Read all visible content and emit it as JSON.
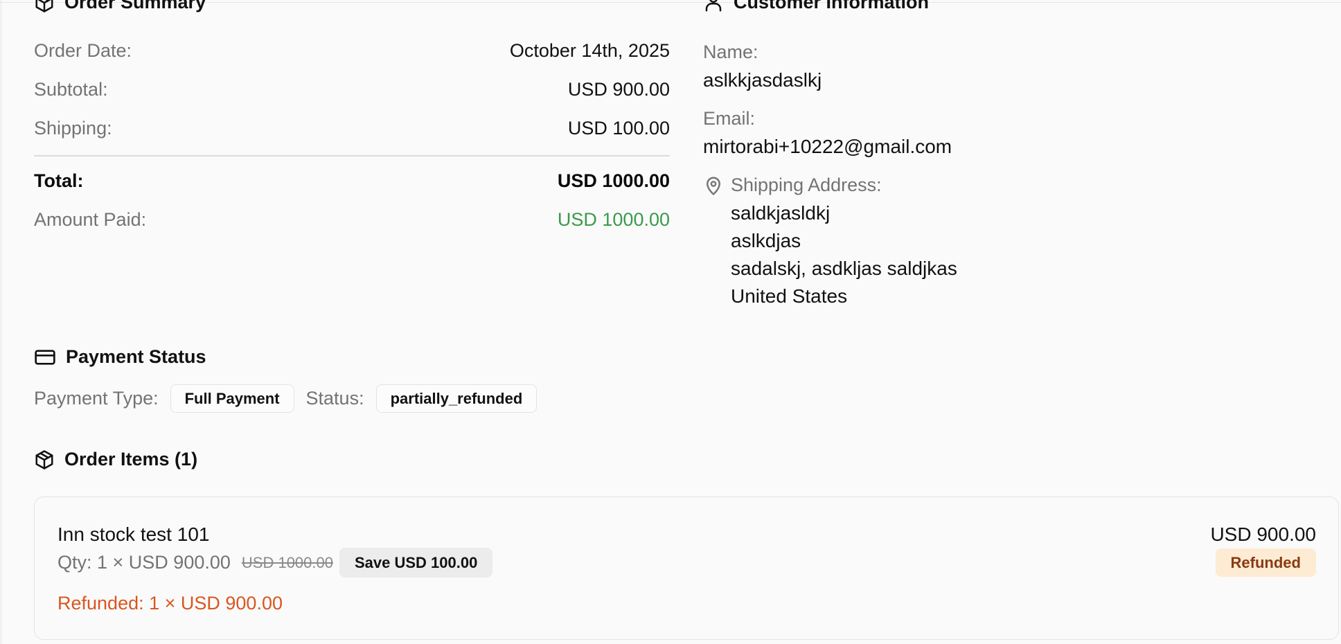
{
  "order_summary": {
    "title": "Order Summary",
    "order_date_label": "Order Date:",
    "order_date_value": "October 14th, 2025",
    "subtotal_label": "Subtotal:",
    "subtotal_value": "USD 900.00",
    "shipping_label": "Shipping:",
    "shipping_value": "USD 100.00",
    "total_label": "Total:",
    "total_value": "USD 1000.00",
    "amount_paid_label": "Amount Paid:",
    "amount_paid_value": "USD 1000.00",
    "icon": "package-icon",
    "paid_color": "#3a9a4a"
  },
  "customer": {
    "title": "Customer Information",
    "icon": "user-icon",
    "name_label": "Name:",
    "name_value": "aslkkjasdaslkj",
    "email_label": "Email:",
    "email_value": "mirtorabi+10222@gmail.com",
    "address_label": "Shipping Address:",
    "address_icon": "map-pin-icon",
    "address_lines": [
      "saldkjasldkj",
      "aslkdjas",
      "sadalskj, asdkljas saldjkas",
      "United States"
    ]
  },
  "payment": {
    "title": "Payment Status",
    "icon": "credit-card-icon",
    "type_label": "Payment Type:",
    "type_value": "Full Payment",
    "status_label": "Status:",
    "status_value": "partially_refunded"
  },
  "items": {
    "title": "Order Items (1)",
    "icon": "package-icon",
    "list": [
      {
        "name": "Inn stock test 101",
        "qty_text": "Qty: 1 × USD 900.00",
        "original_price": "USD 1000.00",
        "save_text": "Save USD 100.00",
        "line_total": "USD 900.00",
        "status_badge": "Refunded",
        "refund_text": "Refunded: 1 × USD 900.00"
      }
    ]
  },
  "colors": {
    "refund_text": "#d9561f",
    "refunded_badge_bg": "#fdebd4",
    "refunded_badge_text": "#8a3a12"
  }
}
